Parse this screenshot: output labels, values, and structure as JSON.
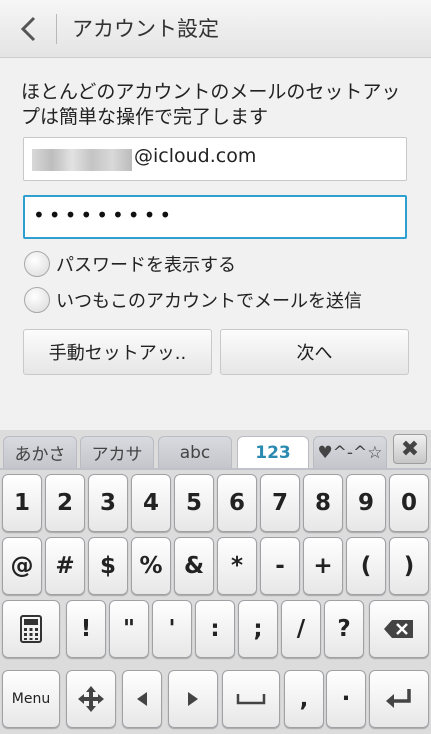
{
  "header": {
    "title": "アカウント設定"
  },
  "form": {
    "description": "ほとんどのアカウントのメールのセットアップは簡単な操作で完了します",
    "email_value": "@icloud.com",
    "password_value": "•••••••••",
    "show_password_label": "パスワードを表示する",
    "send_default_label": "いつもこのアカウントでメールを送信",
    "manual_setup_label": "手動セットアッ..",
    "next_label": "次へ"
  },
  "keyboard": {
    "tabs": [
      "あかさ",
      "アカサ",
      "abc",
      "123",
      "♥^-^☆"
    ],
    "active_tab": "123",
    "close_label": "✖",
    "row1": [
      "1",
      "2",
      "3",
      "4",
      "5",
      "6",
      "7",
      "8",
      "9",
      "0"
    ],
    "row2": [
      "@",
      "#",
      "$",
      "%",
      "&",
      "*",
      "-",
      "+",
      "(",
      ")"
    ],
    "row3": [
      "!",
      "\"",
      "'",
      ":",
      ";",
      "/",
      "?"
    ],
    "menu_label": "Menu",
    "row4_symbols": [
      ",",
      "·"
    ]
  },
  "colors": {
    "accent": "#2f9fd0",
    "active_tab_text": "#2a8ab0"
  }
}
